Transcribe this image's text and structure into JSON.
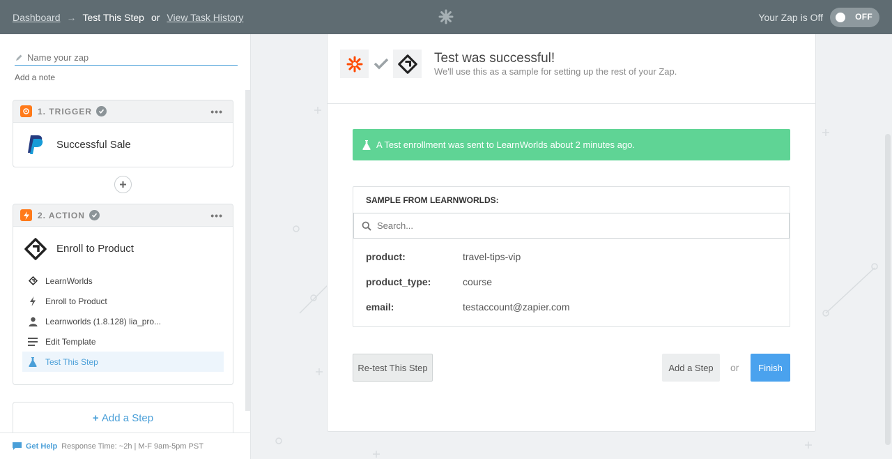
{
  "topbar": {
    "breadcrumb_dashboard": "Dashboard",
    "breadcrumb_arrow": "→",
    "breadcrumb_current": "Test This Step",
    "breadcrumb_or": "or",
    "breadcrumb_history": "View Task History",
    "zap_status": "Your Zap is Off",
    "toggle_label": "OFF"
  },
  "sidebar": {
    "name_placeholder": "Name your zap",
    "add_note": "Add a note",
    "trigger": {
      "header": "1. TRIGGER",
      "app_title": "Successful Sale",
      "menu": "•••"
    },
    "action": {
      "header": "2. ACTION",
      "app_title": "Enroll to Product",
      "menu": "•••",
      "items": [
        {
          "label": "LearnWorlds",
          "icon": "learnworlds-icon"
        },
        {
          "label": "Enroll to Product",
          "icon": "bolt-icon"
        },
        {
          "label": "Learnworlds (1.8.128) lia_pro...",
          "icon": "user-icon"
        },
        {
          "label": "Edit Template",
          "icon": "lines-icon"
        },
        {
          "label": "Test This Step",
          "icon": "flask-icon",
          "active": true
        }
      ]
    },
    "add_step": "Add a Step",
    "help": {
      "label": "Get Help",
      "response": "Response Time: ~2h | M-F 9am-5pm PST"
    }
  },
  "panel": {
    "title": "Test was successful!",
    "subtitle": "We'll use this as a sample for setting up the rest of your Zap.",
    "success_message": "A Test enrollment was sent to LearnWorlds about 2 minutes ago.",
    "sample_title": "SAMPLE FROM LEARNWORLDS:",
    "search_placeholder": "Search...",
    "fields": [
      {
        "key": "product:",
        "value": "travel-tips-vip"
      },
      {
        "key": "product_type:",
        "value": "course"
      },
      {
        "key": "email:",
        "value": "testaccount@zapier.com"
      }
    ],
    "retest_button": "Re-test This Step",
    "add_step_button": "Add a Step",
    "or": "or",
    "finish_button": "Finish"
  },
  "colors": {
    "topbar": "#5f6c72",
    "accent_blue": "#4aa2ee",
    "success_green": "#5fd495",
    "zapier_orange": "#ff4a00",
    "trigger_orange": "#ff7a1a"
  }
}
